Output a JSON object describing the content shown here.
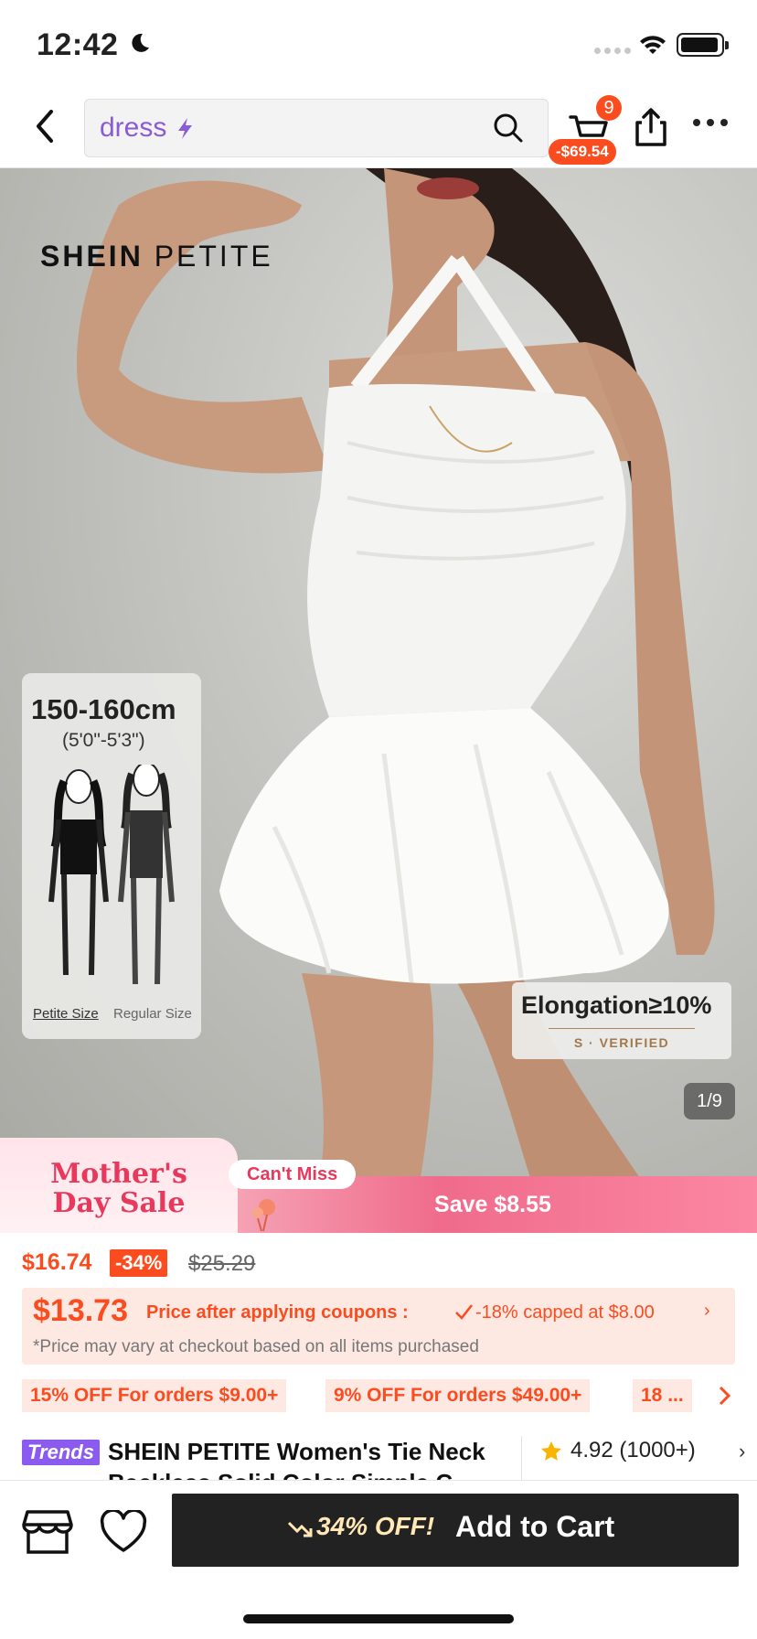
{
  "status_bar": {
    "time": "12:42"
  },
  "nav": {
    "search_query": "dress",
    "cart_count": "9",
    "cart_savings": "-$69.54"
  },
  "hero": {
    "brand_bold": "SHEIN",
    "brand_light": " PETITE",
    "size_card": {
      "height_cm": "150-160cm",
      "height_ft": "(5'0\"-5'3\")",
      "petite_label": "Petite Size",
      "regular_label": "Regular Size"
    },
    "elongation": "Elongation≥10%",
    "verified": "S · VERIFIED",
    "pager": "1/9"
  },
  "promo": {
    "title": "Mother's Day Sale",
    "cant_miss": "Can't Miss",
    "save": "Save $8.55"
  },
  "price": {
    "current": "$16.74",
    "discount": "-34%",
    "original": "$25.29"
  },
  "coupon": {
    "final_price": "$13.73",
    "after_label": "Price after applying coupons :",
    "cap_text": "-18% capped at $8.00",
    "note": "*Price may vary at checkout based on all items purchased"
  },
  "offers": [
    "15% OFF For orders $9.00+",
    "9% OFF For orders $49.00+",
    "18 ..."
  ],
  "product": {
    "trend_badge": "Trends",
    "title": "SHEIN PETITE Women's Tie Neck Backless Solid Color Simple C...",
    "rating": "4.92 (1000+)"
  },
  "bottom_bar": {
    "discount": "34% OFF!",
    "add_to_cart": "Add to Cart"
  },
  "colors": {
    "accent_orange": "#fa4c1f",
    "trend_purple": "#8b5bf0",
    "promo_pink": "#e8395c",
    "cta_dark": "#222222"
  }
}
